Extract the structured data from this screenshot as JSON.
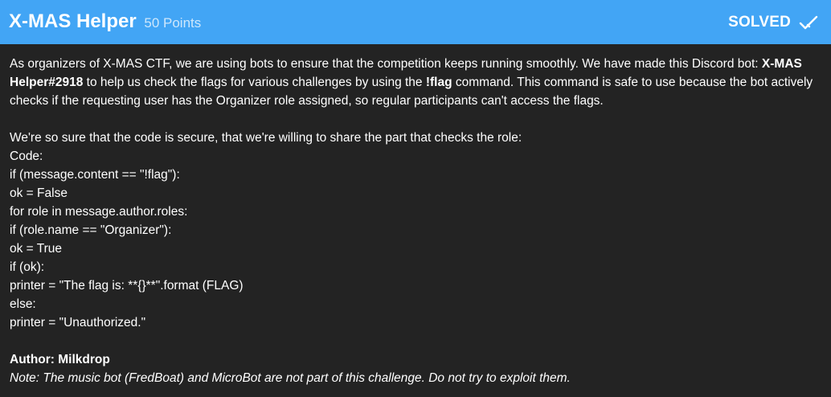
{
  "challenge": {
    "title": "X-MAS Helper",
    "points": "50 Points",
    "status": "SOLVED"
  },
  "description": {
    "p1_a": "As organizers of X-MAS CTF, we are using bots to ensure that the competition keeps running smoothly. We have made this Discord bot: ",
    "bot_name": "X-MAS Helper#2918",
    "p1_b": " to help us check the flags for various challenges by using the ",
    "command": "!flag",
    "p1_c": " command. This command is safe to use because the bot actively checks if the requesting user has the Organizer role assigned, so regular participants can't access the flags.",
    "p2": "We're so sure that the code is secure, that we're willing to share the part that checks the role:",
    "code_label": "Code:",
    "code_lines": [
      "if (message.content == \"!flag\"):",
      "ok = False",
      "for role in message.author.roles:",
      "if (role.name == \"Organizer\"):",
      "ok = True",
      "if (ok):",
      "printer = \"The flag is: **{}**\".format (FLAG)",
      "else:",
      "printer = \"Unauthorized.\""
    ],
    "author": "Author: Milkdrop",
    "note": "Note: The music bot (FredBoat) and MicroBot are not part of this challenge. Do not try to exploit them."
  },
  "colors": {
    "header_bg": "#42a5f5",
    "body_bg": "#232323",
    "text": "#ffffff"
  },
  "icons": {
    "solved": "checkmark-icon"
  }
}
